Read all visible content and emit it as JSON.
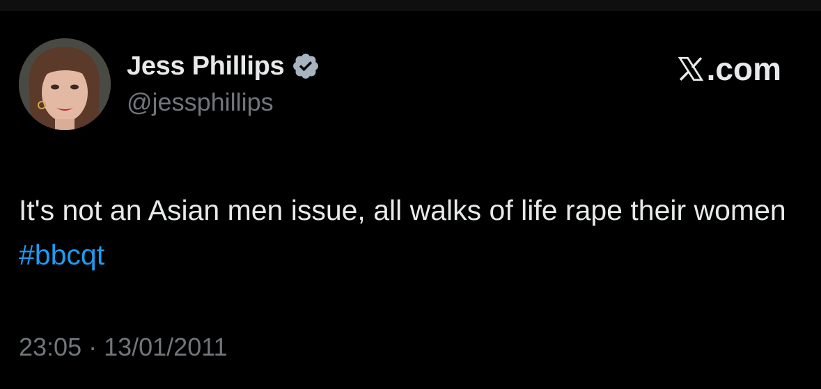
{
  "author": {
    "display_name": "Jess Phillips",
    "handle": "@jessphillips",
    "verified": true,
    "avatar_icon": "profile-photo"
  },
  "brand": {
    "label": ".com",
    "icon": "x-logo-icon"
  },
  "tweet": {
    "text_part1": "It's not an Asian men issue, all walks of life rape their women ",
    "hashtag": "#bbcqt"
  },
  "meta": {
    "time": "23:05",
    "separator": "·",
    "date": "13/01/2011"
  },
  "colors": {
    "background": "#000000",
    "text": "#e7e9ea",
    "secondary_text": "#71767b",
    "link": "#1d9bf0",
    "verified_badge": "#a7b3bf"
  }
}
